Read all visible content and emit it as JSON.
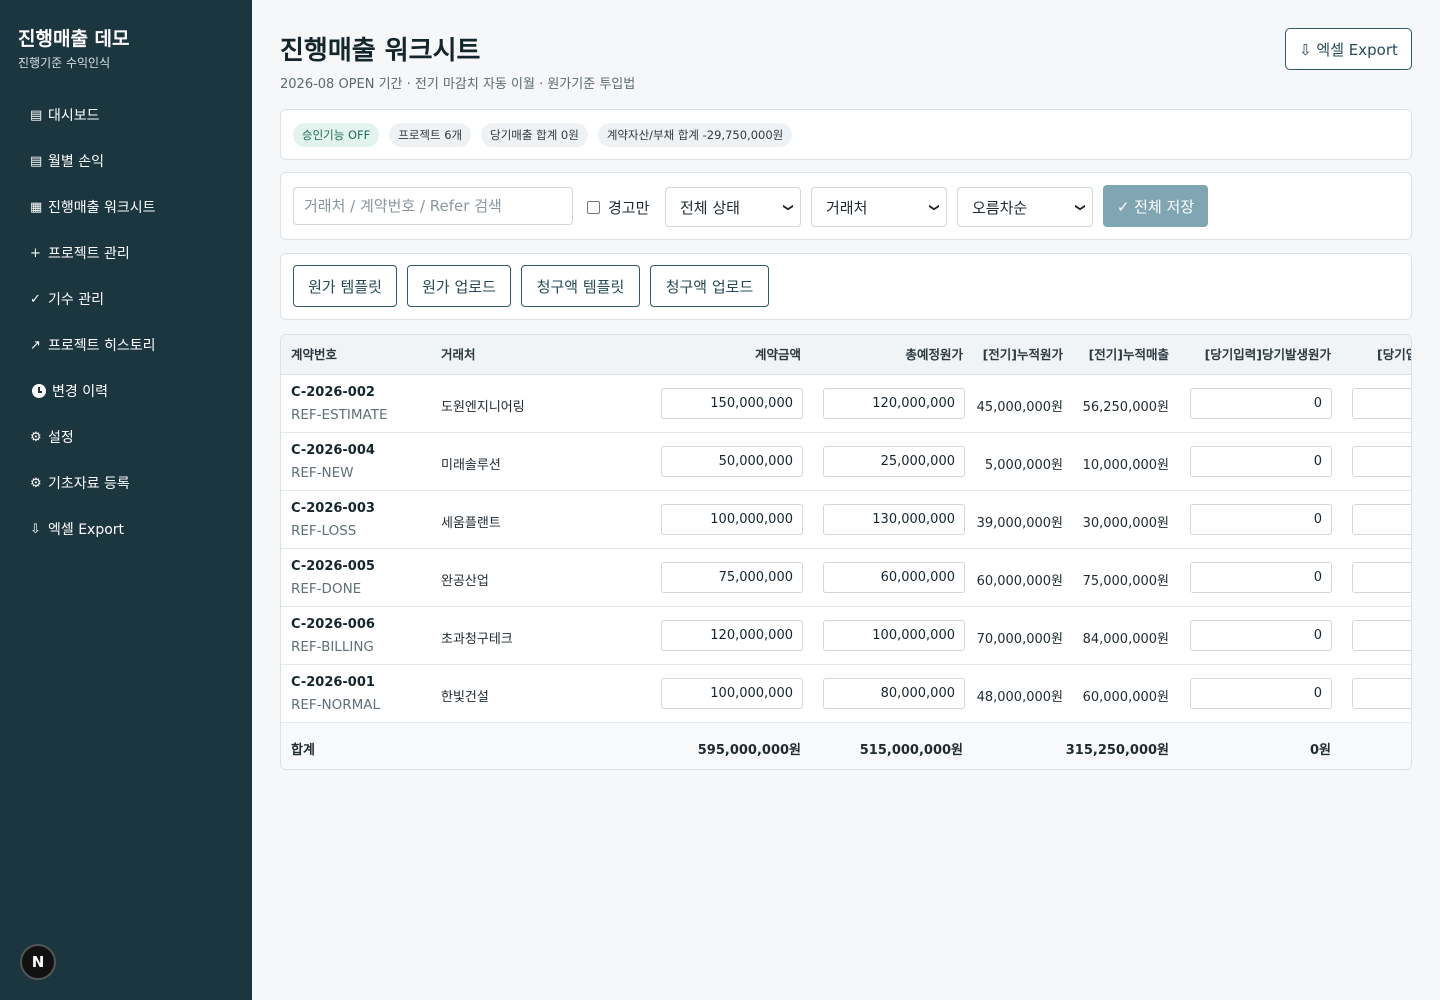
{
  "sidebar": {
    "title": "진행매출 데모",
    "subtitle": "진행기준 수익인식",
    "items": [
      {
        "icon": "▤",
        "label": "대시보드"
      },
      {
        "icon": "▤",
        "label": "월별 손익"
      },
      {
        "icon": "▦",
        "label": "진행매출 워크시트"
      },
      {
        "icon": "+",
        "label": "프로젝트 관리"
      },
      {
        "icon": "✓",
        "label": "기수 관리"
      },
      {
        "icon": "↗",
        "label": "프로젝트 히스토리"
      },
      {
        "icon": "clock",
        "label": "변경 이력"
      },
      {
        "icon": "⚙",
        "label": "설정"
      },
      {
        "icon": "⚙",
        "label": "기초자료 등록"
      },
      {
        "icon": "⇩",
        "label": "엑셀 Export"
      }
    ],
    "badge": "N"
  },
  "header": {
    "title": "진행매출 워크시트",
    "subtitle": "2026-08 OPEN 기간 · 전기 마감치 자동 이월 · 원가기준 투입법",
    "export_label": "⇩ 엑셀 Export"
  },
  "badges": [
    "승인기능 OFF",
    "프로젝트 6개",
    "당기매출 합계 0원",
    "계약자산/부채 합계 -29,750,000원"
  ],
  "filters": {
    "search_placeholder": "거래처 / 계약번호 / Refer 검색",
    "warning_only_label": "경고만",
    "status_select": "전체 상태",
    "client_select": "거래처",
    "sort_select": "오름차순",
    "save_label": "✓ 전체 저장"
  },
  "uploads": [
    "원가 템플릿",
    "원가 업로드",
    "청구액 템플릿",
    "청구액 업로드"
  ],
  "table": {
    "headers": [
      "계약번호",
      "거래처",
      "계약금액",
      "총예정원가",
      "[전기]누적원가",
      "[전기]누적매출",
      "[당기입력]당기발생원가",
      "[당기입"
    ],
    "rows": [
      {
        "id": "C-2026-002",
        "ref": "REF-ESTIMATE",
        "client": "도원엔지니어링",
        "contract": "150,000,000",
        "est_cost": "120,000,000",
        "prev_cost": "45,000,000원",
        "prev_rev": "56,250,000원",
        "cur_cost": "0"
      },
      {
        "id": "C-2026-004",
        "ref": "REF-NEW",
        "client": "미래솔루션",
        "contract": "50,000,000",
        "est_cost": "25,000,000",
        "prev_cost": "5,000,000원",
        "prev_rev": "10,000,000원",
        "cur_cost": "0"
      },
      {
        "id": "C-2026-003",
        "ref": "REF-LOSS",
        "client": "세움플랜트",
        "contract": "100,000,000",
        "est_cost": "130,000,000",
        "prev_cost": "39,000,000원",
        "prev_rev": "30,000,000원",
        "cur_cost": "0"
      },
      {
        "id": "C-2026-005",
        "ref": "REF-DONE",
        "client": "완공산업",
        "contract": "75,000,000",
        "est_cost": "60,000,000",
        "prev_cost": "60,000,000원",
        "prev_rev": "75,000,000원",
        "cur_cost": "0"
      },
      {
        "id": "C-2026-006",
        "ref": "REF-BILLING",
        "client": "초과청구테크",
        "contract": "120,000,000",
        "est_cost": "100,000,000",
        "prev_cost": "70,000,000원",
        "prev_rev": "84,000,000원",
        "cur_cost": "0"
      },
      {
        "id": "C-2026-001",
        "ref": "REF-NORMAL",
        "client": "한빛건설",
        "contract": "100,000,000",
        "est_cost": "80,000,000",
        "prev_cost": "48,000,000원",
        "prev_rev": "60,000,000원",
        "cur_cost": "0"
      }
    ],
    "totals": {
      "label": "합계",
      "contract": "595,000,000원",
      "est_cost": "515,000,000원",
      "prev_rev": "315,250,000원",
      "cur_cost": "0원"
    }
  }
}
